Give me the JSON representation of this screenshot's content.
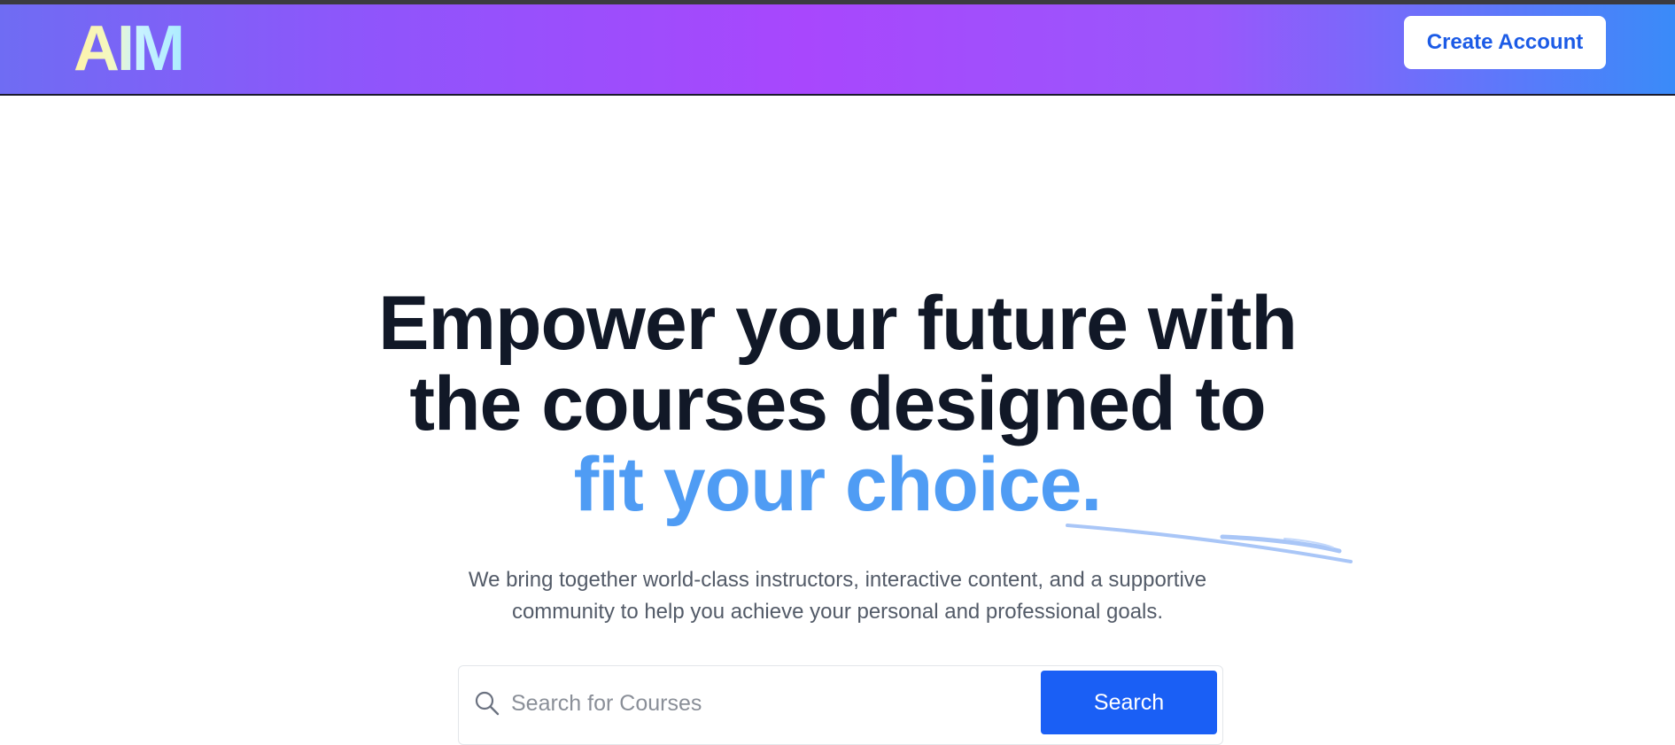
{
  "navbar": {
    "logo_text": "AIM",
    "create_account_label": "Create Account"
  },
  "hero": {
    "title_line1": "Empower your future with",
    "title_line2": "the courses designed to",
    "title_highlight": "fit your choice.",
    "subtitle_line1": "We bring together world-class instructors, interactive content, and a supportive",
    "subtitle_line2": "community to help you achieve your personal and professional goals."
  },
  "search": {
    "placeholder": "Search for Courses",
    "value": "",
    "button_label": "Search",
    "icon": "search-icon"
  },
  "colors": {
    "accent": "#1a5ff5",
    "highlight": "#4f9cf4",
    "heading": "#111827",
    "nav_gradient_start": "#6f6cf3",
    "nav_gradient_mid": "#a847fd",
    "nav_gradient_end": "#3a8bf9"
  }
}
